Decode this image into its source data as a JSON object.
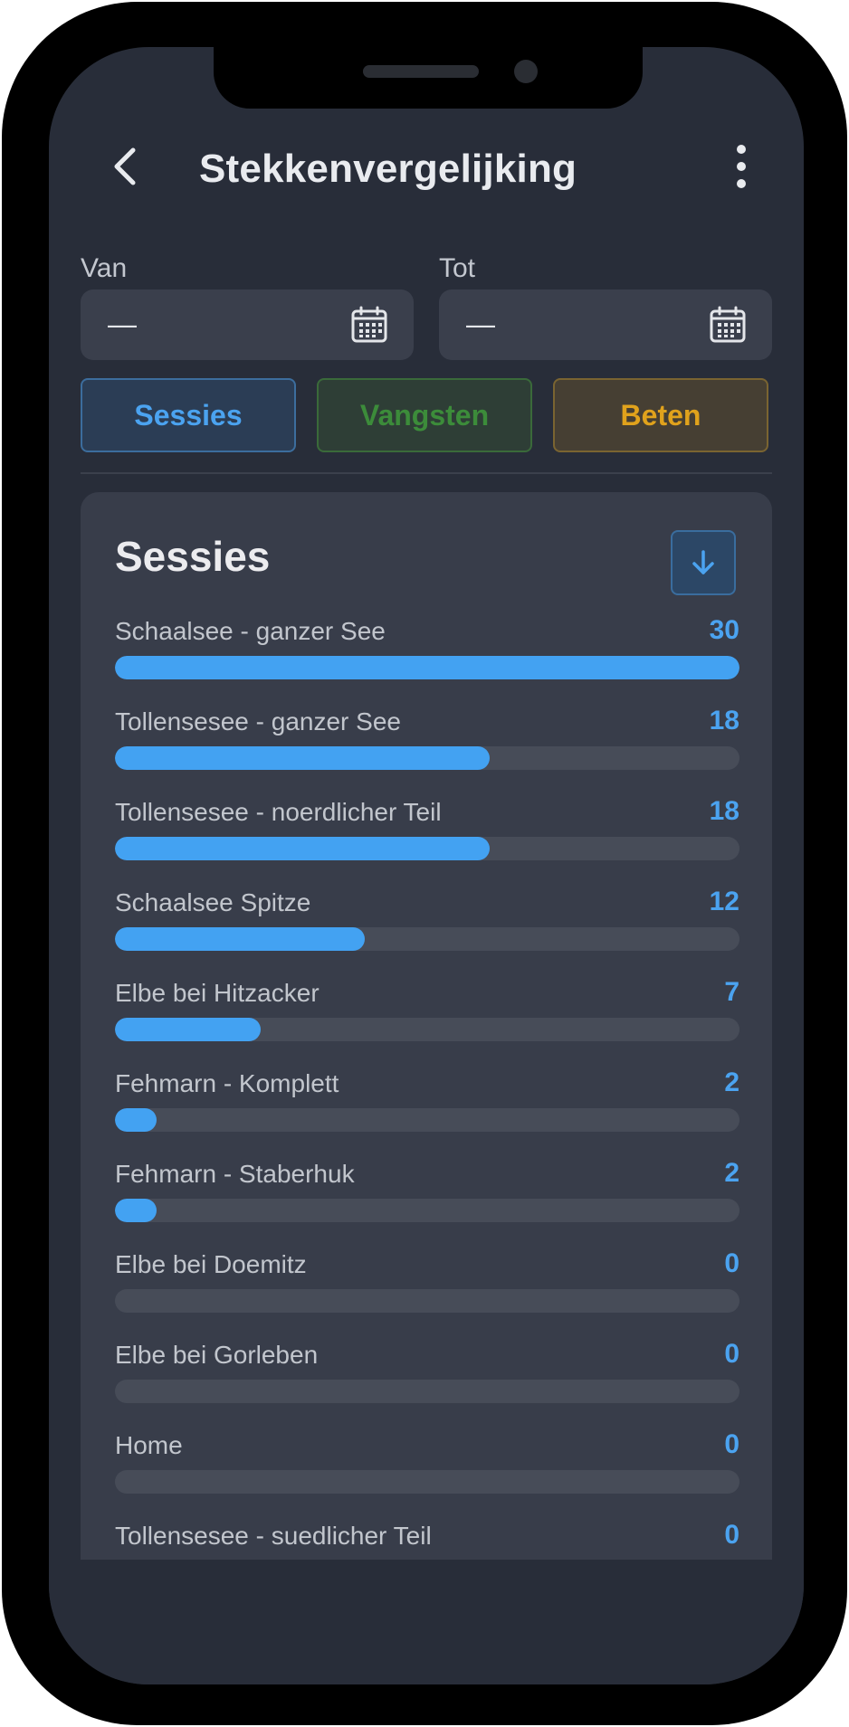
{
  "header": {
    "title": "Stekkenvergelijking"
  },
  "icons": {
    "back": "chevron-left-icon",
    "menu": "more-vertical-icon",
    "calendar": "calendar-icon",
    "sort": "arrow-down-icon"
  },
  "filters": {
    "from": {
      "label": "Van",
      "value": "—"
    },
    "to": {
      "label": "Tot",
      "value": "—"
    }
  },
  "tabs": [
    {
      "label": "Sessies",
      "color": "#4ba3f0",
      "bg": "#2b3d55",
      "border": "#3c6d9d",
      "active": true
    },
    {
      "label": "Vangsten",
      "color": "#3c8c3a",
      "bg": "#2e3e36",
      "border": "#3a6a3a",
      "active": false
    },
    {
      "label": "Beten",
      "color": "#e0a21c",
      "bg": "#463f33",
      "border": "#7a6431",
      "active": false
    }
  ],
  "card": {
    "title": "Sessies",
    "max": 30
  },
  "items": [
    {
      "name": "Schaalsee - ganzer See",
      "value": 30
    },
    {
      "name": "Tollensesee - ganzer See",
      "value": 18
    },
    {
      "name": "Tollensesee - noerdlicher Teil",
      "value": 18
    },
    {
      "name": "Schaalsee Spitze",
      "value": 12
    },
    {
      "name": "Elbe bei Hitzacker",
      "value": 7
    },
    {
      "name": "Fehmarn - Komplett",
      "value": 2
    },
    {
      "name": "Fehmarn - Staberhuk",
      "value": 2
    },
    {
      "name": "Elbe bei Doemitz",
      "value": 0
    },
    {
      "name": "Elbe bei Gorleben",
      "value": 0
    },
    {
      "name": "Home",
      "value": 0
    },
    {
      "name": "Tollensesee - suedlicher Teil",
      "value": 0
    }
  ]
}
